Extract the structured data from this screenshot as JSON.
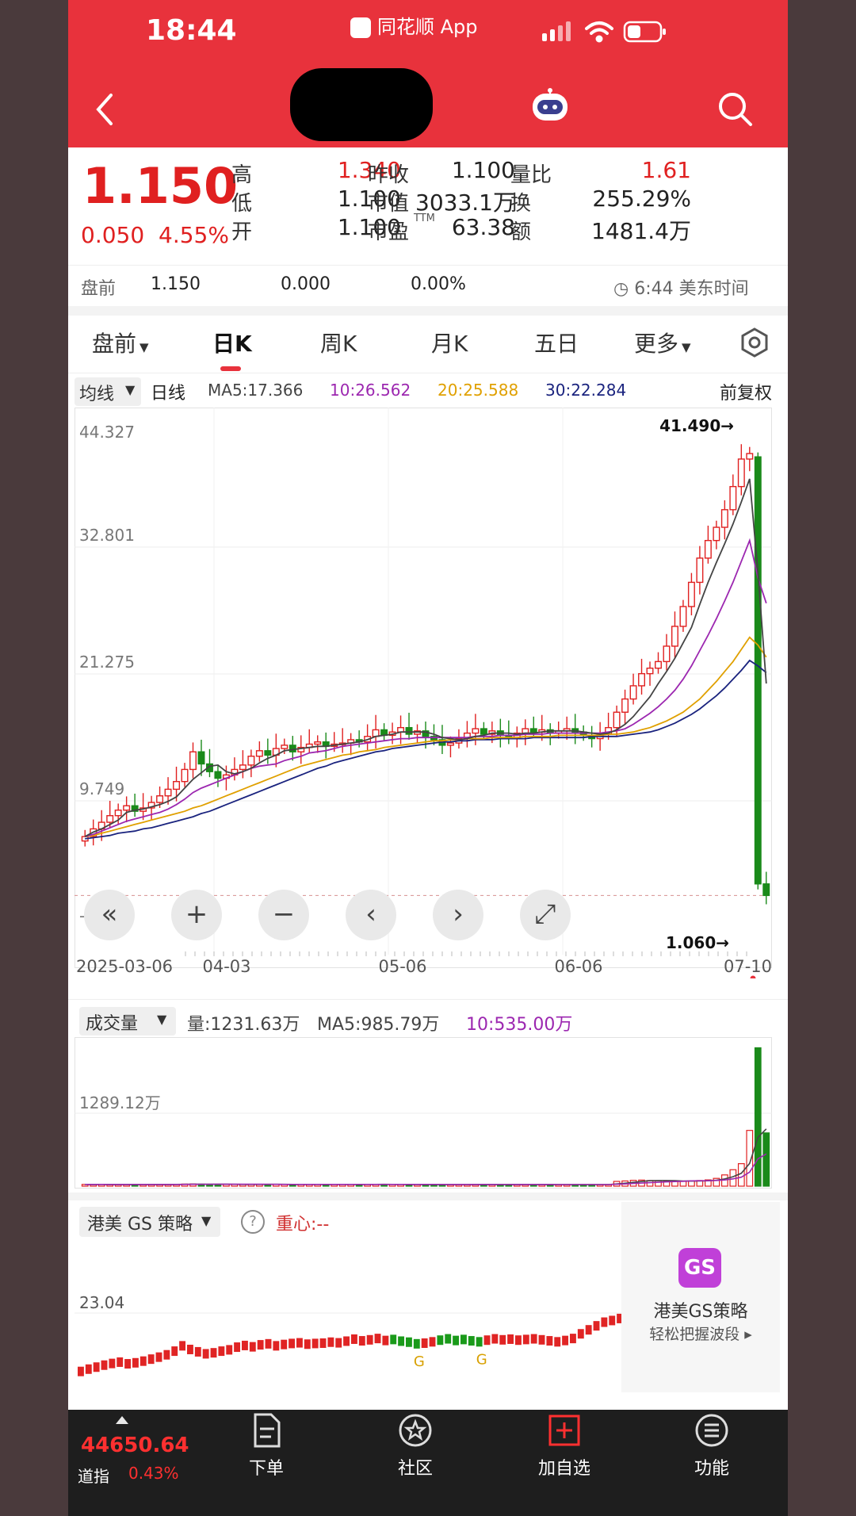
{
  "status_bar": {
    "time": "18:44",
    "app": "同花顺 App"
  },
  "quote": {
    "price": "1.150",
    "change": "0.050",
    "change_pct": "4.55%",
    "stats": [
      {
        "label": "高",
        "value": "1.340",
        "color": "red"
      },
      {
        "label": "低",
        "value": "1.100",
        "color": "dark"
      },
      {
        "label": "开",
        "value": "1.100",
        "color": "dark"
      },
      {
        "label": "昨收",
        "value": "1.100",
        "color": "dark"
      },
      {
        "label": "市值",
        "value": "3033.1万",
        "color": "dark"
      },
      {
        "label": "市盈",
        "value": "63.38",
        "color": "dark",
        "sup": "TTM"
      },
      {
        "label": "量比",
        "value": "1.61",
        "color": "red"
      },
      {
        "label": "换",
        "value": "255.29%",
        "color": "dark"
      },
      {
        "label": "额",
        "value": "1481.4万",
        "color": "dark"
      }
    ],
    "premarket": {
      "label": "盘前",
      "price": "1.150",
      "change": "0.000",
      "pct": "0.00%",
      "time": "6:44 美东时间"
    }
  },
  "tabs": [
    "盘前",
    "日K",
    "周K",
    "月K",
    "五日",
    "更多"
  ],
  "active_tab": 1,
  "kline": {
    "ma_selector": "均线",
    "period": "日线",
    "ma5": "MA5:17.366",
    "ma10": "10:26.562",
    "ma20": "20:25.588",
    "ma30": "30:22.284",
    "adjust": "前复权",
    "high_marker": "41.490→",
    "low_marker": "1.060→",
    "controls": [
      "«",
      "+",
      "−",
      "‹",
      "›",
      "⤢"
    ]
  },
  "volume": {
    "selector": "成交量",
    "vol": "量:1231.63万",
    "ma5": "MA5:985.79万",
    "ma10": "10:535.00万"
  },
  "indicator": {
    "selector": "港美 GS 策略",
    "help": "?",
    "center": "重心:--",
    "ad_badge": "GS",
    "ad_title": "港美GS策略",
    "ad_sub": "轻松把握波段 ▸",
    "g_labels": [
      "G",
      "G"
    ]
  },
  "bottom_nav": {
    "index_value": "44650.64",
    "index_name": "道指",
    "index_pct": "0.43%",
    "items": [
      {
        "label": "下单",
        "icon": "document-icon"
      },
      {
        "label": "社区",
        "icon": "star-badge-icon"
      },
      {
        "label": "加自选",
        "icon": "add-box-icon"
      },
      {
        "label": "功能",
        "icon": "menu-circle-icon"
      }
    ]
  },
  "colors": {
    "up": "#e02020",
    "down": "#1a8a1a",
    "brand": "#e8323c",
    "ma10": "#9c27b0",
    "ma20": "#e0a000",
    "ma30": "#1a237e"
  },
  "chart_data": {
    "type": "candlestick",
    "y_ticks": [
      "44.327",
      "32.801",
      "21.275",
      "9.749",
      "-1.777"
    ],
    "ylim": [
      -1.777,
      44.327
    ],
    "x_ticks": [
      "2025-03-06",
      "04-03",
      "05-06",
      "06-06",
      "07-10"
    ],
    "closes": [
      6.5,
      7.2,
      7.8,
      8.4,
      8.9,
      9.3,
      8.8,
      9.1,
      9.6,
      10.2,
      10.8,
      11.5,
      12.6,
      14.2,
      13.1,
      12.4,
      11.8,
      12.1,
      12.6,
      13.0,
      13.8,
      14.3,
      13.9,
      14.5,
      14.8,
      14.2,
      14.6,
      14.9,
      15.1,
      14.7,
      14.9,
      15.0,
      15.3,
      15.1,
      15.6,
      16.2,
      15.7,
      16.0,
      16.4,
      15.8,
      16.1,
      15.6,
      15.3,
      14.8,
      15.0,
      15.4,
      15.9,
      16.3,
      15.8,
      16.1,
      15.7,
      15.4,
      15.9,
      16.3,
      16.0,
      16.2,
      15.9,
      16.1,
      16.3,
      16.0,
      15.7,
      15.4,
      15.8,
      16.4,
      17.8,
      19.0,
      20.2,
      21.3,
      21.8,
      22.4,
      23.8,
      25.6,
      27.4,
      29.6,
      31.8,
      33.4,
      34.6,
      36.2,
      38.3,
      40.8,
      41.3,
      2.2,
      1.15
    ],
    "ma5": [
      6.5,
      6.9,
      7.2,
      7.6,
      8.0,
      8.7,
      8.9,
      9.0,
      9.2,
      9.4,
      9.7,
      10.1,
      10.9,
      11.7,
      12.3,
      12.9,
      13.0,
      12.4,
      12.2,
      12.4,
      12.7,
      13.2,
      13.6,
      13.9,
      14.3,
      14.4,
      14.5,
      14.6,
      14.7,
      14.7,
      14.8,
      14.9,
      15.0,
      15.1,
      15.3,
      15.6,
      15.7,
      15.8,
      16.0,
      16.0,
      16.0,
      16.0,
      15.8,
      15.5,
      15.4,
      15.3,
      15.4,
      15.6,
      15.7,
      15.9,
      15.9,
      15.9,
      15.8,
      15.9,
      15.9,
      16.0,
      16.1,
      16.1,
      16.1,
      16.1,
      16.0,
      15.9,
      15.8,
      15.9,
      16.2,
      16.7,
      17.4,
      18.3,
      19.2,
      20.4,
      21.5,
      22.7,
      24.1,
      25.5,
      27.6,
      29.6,
      31.4,
      33.1,
      34.9,
      36.9,
      39.0,
      30.5,
      20.4
    ],
    "ma10": [
      6.5,
      6.7,
      7.0,
      7.3,
      7.6,
      7.9,
      8.1,
      8.3,
      8.5,
      8.7,
      9.0,
      9.4,
      9.9,
      10.5,
      10.9,
      11.2,
      11.5,
      11.8,
      12.1,
      12.4,
      12.7,
      12.9,
      13.0,
      13.1,
      13.4,
      13.6,
      13.8,
      14.1,
      14.2,
      14.3,
      14.5,
      14.7,
      14.8,
      14.9,
      15.0,
      15.1,
      15.2,
      15.3,
      15.4,
      15.4,
      15.5,
      15.5,
      15.5,
      15.5,
      15.5,
      15.5,
      15.5,
      15.6,
      15.6,
      15.6,
      15.7,
      15.7,
      15.7,
      15.8,
      15.8,
      15.8,
      15.9,
      15.9,
      15.9,
      15.9,
      15.9,
      15.9,
      15.9,
      16.0,
      16.1,
      16.3,
      16.7,
      17.2,
      17.7,
      18.3,
      19.0,
      19.8,
      20.8,
      22.0,
      23.4,
      24.8,
      26.3,
      27.9,
      29.6,
      31.5,
      33.4,
      30.0,
      27.7
    ],
    "ma20": [
      6.5,
      6.6,
      6.8,
      7.0,
      7.2,
      7.4,
      7.6,
      7.8,
      8.0,
      8.2,
      8.4,
      8.6,
      8.8,
      9.1,
      9.3,
      9.6,
      9.9,
      10.2,
      10.5,
      10.8,
      11.1,
      11.4,
      11.7,
      12.0,
      12.3,
      12.6,
      12.9,
      13.1,
      13.3,
      13.5,
      13.7,
      13.9,
      14.0,
      14.2,
      14.3,
      14.4,
      14.6,
      14.7,
      14.8,
      14.9,
      15.0,
      15.1,
      15.2,
      15.2,
      15.3,
      15.3,
      15.4,
      15.4,
      15.4,
      15.5,
      15.5,
      15.5,
      15.5,
      15.6,
      15.6,
      15.6,
      15.6,
      15.7,
      15.7,
      15.7,
      15.7,
      15.7,
      15.7,
      15.8,
      15.8,
      15.9,
      16.0,
      16.2,
      16.4,
      16.7,
      17.0,
      17.4,
      17.8,
      18.4,
      19.0,
      19.8,
      20.6,
      21.5,
      22.4,
      23.5,
      24.6,
      23.9,
      22.8
    ],
    "ma30": [
      6.3,
      6.4,
      6.5,
      6.6,
      6.8,
      6.9,
      7.0,
      7.2,
      7.3,
      7.5,
      7.7,
      7.9,
      8.1,
      8.3,
      8.6,
      8.8,
      9.1,
      9.4,
      9.7,
      10.0,
      10.3,
      10.6,
      10.9,
      11.2,
      11.5,
      11.8,
      12.1,
      12.4,
      12.7,
      12.9,
      13.2,
      13.4,
      13.6,
      13.8,
      14.0,
      14.2,
      14.3,
      14.5,
      14.6,
      14.7,
      14.8,
      14.9,
      15.0,
      15.1,
      15.1,
      15.2,
      15.2,
      15.3,
      15.3,
      15.3,
      15.4,
      15.4,
      15.4,
      15.4,
      15.5,
      15.5,
      15.5,
      15.5,
      15.5,
      15.5,
      15.5,
      15.6,
      15.6,
      15.6,
      15.6,
      15.7,
      15.8,
      15.9,
      16.0,
      16.2,
      16.5,
      16.8,
      17.2,
      17.6,
      18.1,
      18.7,
      19.3,
      20.0,
      20.8,
      21.6,
      22.5,
      22.0,
      21.4
    ],
    "volume_ytick": "1289.12万",
    "volumes": [
      40,
      38,
      42,
      35,
      37,
      40,
      36,
      38,
      39,
      41,
      42,
      44,
      48,
      50,
      46,
      43,
      40,
      39,
      41,
      40,
      42,
      44,
      40,
      41,
      42,
      39,
      40,
      41,
      42,
      40,
      38,
      39,
      40,
      41,
      42,
      44,
      40,
      39,
      41,
      38,
      39,
      37,
      36,
      35,
      36,
      38,
      39,
      40,
      38,
      39,
      37,
      36,
      38,
      39,
      37,
      38,
      36,
      37,
      38,
      36,
      35,
      34,
      36,
      38,
      110,
      120,
      135,
      140,
      130,
      125,
      120,
      115,
      110,
      120,
      130,
      145,
      180,
      260,
      380,
      520,
      1289,
      3200,
      1231.63
    ],
    "indicator_ytick": "23.04"
  }
}
